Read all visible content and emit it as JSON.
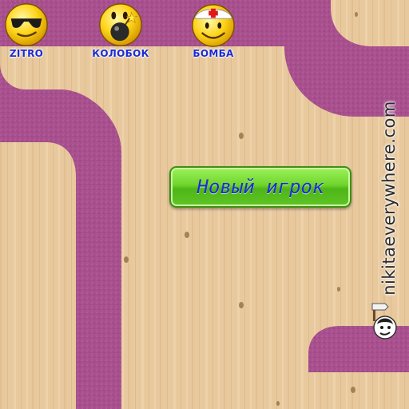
{
  "players": [
    {
      "name": "ZITRO",
      "icon": "sunglasses-smiley-icon"
    },
    {
      "name": "КОЛОБОК",
      "icon": "bomb-smiley-icon"
    },
    {
      "name": "БОМБА",
      "icon": "medic-cap-smiley-icon"
    }
  ],
  "new_player_button": {
    "label": "Новый игрок"
  },
  "site": {
    "label": "nikitaeverywhere.com"
  },
  "colors": {
    "wood": "#e6c79c",
    "track": "#a44b8a",
    "button": "#6fd52c",
    "button_text": "#1d2bd8",
    "player_name": "#1c2ad6"
  }
}
